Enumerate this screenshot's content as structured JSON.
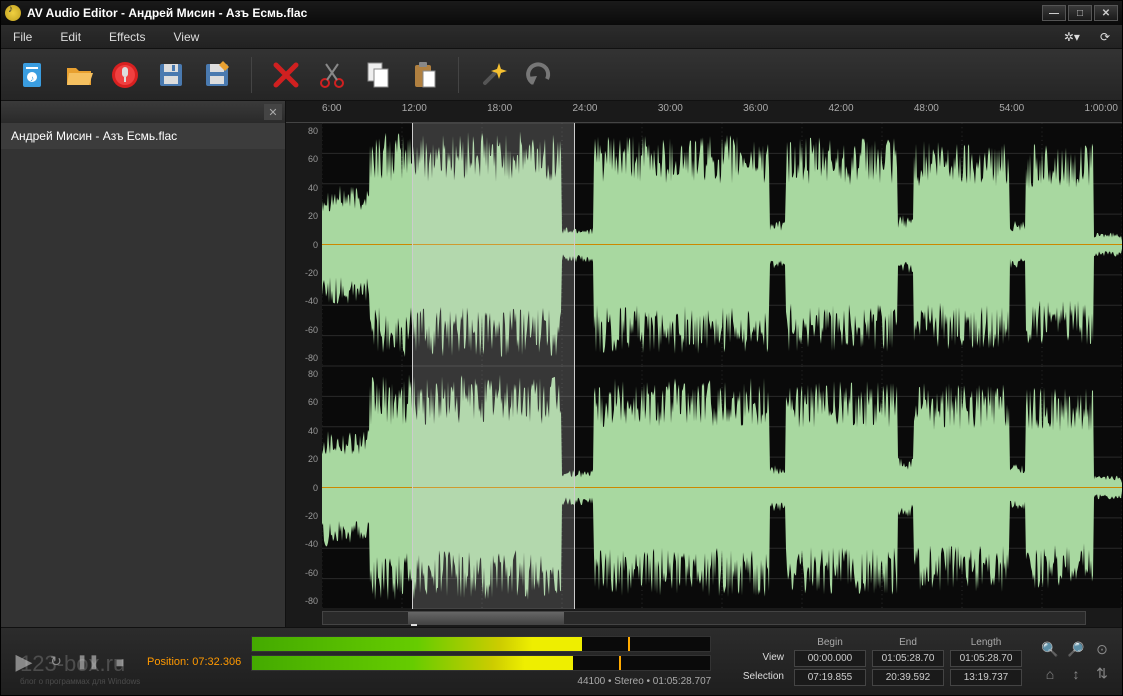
{
  "title": "AV Audio Editor - Андрей Мисин - Азъ Есмь.flac",
  "menu": {
    "file": "File",
    "edit": "Edit",
    "effects": "Effects",
    "view": "View"
  },
  "sidebar": {
    "file": "Андрей Мисин - Азъ Есмь.flac"
  },
  "ruler": [
    "6:00",
    "12:00",
    "18:00",
    "24:00",
    "30:00",
    "36:00",
    "42:00",
    "48:00",
    "54:00",
    "1:00:00"
  ],
  "db_scale": [
    "80",
    "60",
    "40",
    "20",
    "0",
    "-20",
    "-40",
    "-60",
    "-80"
  ],
  "position_label": "Position:",
  "position_value": "07:32.306",
  "meter_info": "44100 • Stereo • 01:05:28.707",
  "table": {
    "begin": "Begin",
    "end": "End",
    "length": "Length",
    "view": "View",
    "selection": "Selection",
    "view_begin": "00:00.000",
    "view_end": "01:05:28.70",
    "view_length": "01:05:28.70",
    "sel_begin": "07:19.855",
    "sel_end": "20:39.592",
    "sel_length": "13:19.737"
  },
  "selection_pct": {
    "left": 11.2,
    "width": 20.4
  },
  "cursor_pct": 11.5,
  "watermark": "123-box.ru",
  "watermark_sub": "блог о программах для Windows"
}
